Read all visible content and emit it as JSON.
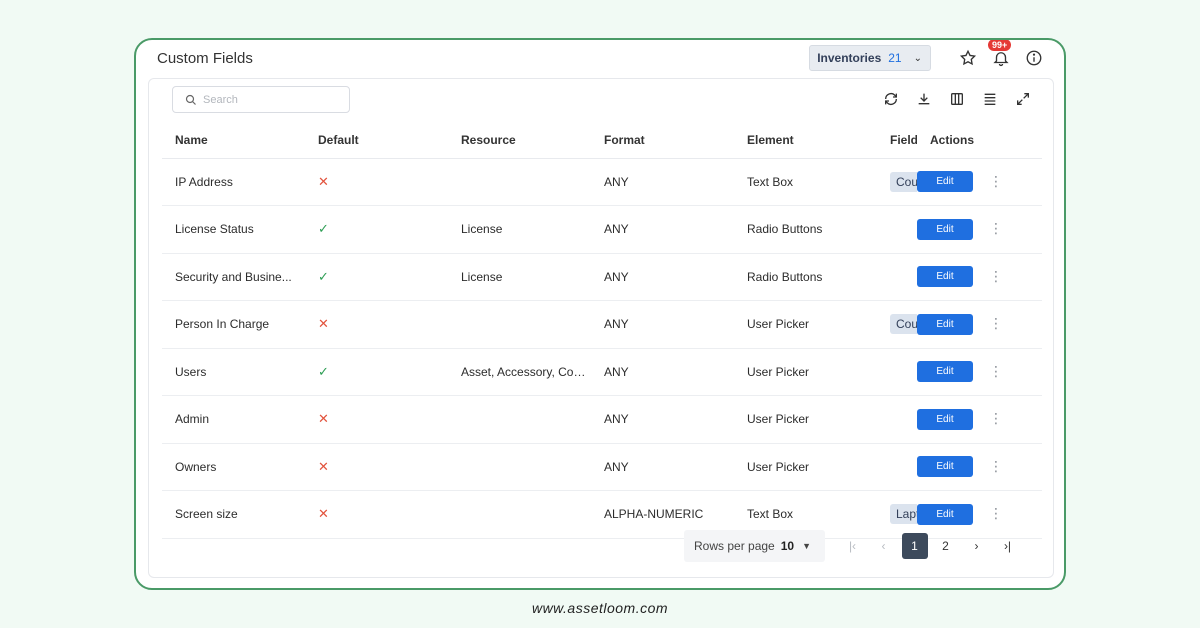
{
  "page": {
    "title": "Custom Fields"
  },
  "topbar": {
    "inventory_label": "Inventories",
    "inventory_count": "21",
    "notification_badge": "99+"
  },
  "search": {
    "placeholder": "Search"
  },
  "toolbar": {
    "icons": [
      "refresh-icon",
      "download-icon",
      "columns-icon",
      "density-icon",
      "fullscreen-icon"
    ]
  },
  "table": {
    "headers": [
      "Name",
      "Default",
      "Resource",
      "Format",
      "Element",
      "Field",
      "Actions"
    ],
    "rows": [
      {
        "name": "IP Address",
        "default": false,
        "resource": "",
        "format": "ANY",
        "element": "Text Box",
        "field": "Cou"
      },
      {
        "name": "License Status",
        "default": true,
        "resource": "License",
        "format": "ANY",
        "element": "Radio Buttons",
        "field": ""
      },
      {
        "name": "Security and Busine...",
        "default": true,
        "resource": "License",
        "format": "ANY",
        "element": "Radio Buttons",
        "field": ""
      },
      {
        "name": "Person In Charge",
        "default": false,
        "resource": "",
        "format": "ANY",
        "element": "User Picker",
        "field": "Cou"
      },
      {
        "name": "Users",
        "default": true,
        "resource": "Asset, Accessory, Compo",
        "format": "ANY",
        "element": "User Picker",
        "field": ""
      },
      {
        "name": "Admin",
        "default": false,
        "resource": "",
        "format": "ANY",
        "element": "User Picker",
        "field": ""
      },
      {
        "name": "Owners",
        "default": false,
        "resource": "",
        "format": "ANY",
        "element": "User Picker",
        "field": ""
      },
      {
        "name": "Screen size",
        "default": false,
        "resource": "",
        "format": "ALPHA-NUMERIC",
        "element": "Text Box",
        "field": "Lapt"
      }
    ],
    "edit_label": "Edit",
    "true_glyph": "✓",
    "false_glyph": "✕"
  },
  "pagination": {
    "rows_per_page_label": "Rows per page",
    "rows_per_page_value": "10",
    "pages": [
      "1",
      "2"
    ],
    "current_page": "1"
  },
  "footer": {
    "url": "www.assetloom.com"
  },
  "colors": {
    "accent": "#1f6fe0",
    "frame_border": "#4a9a67",
    "error": "#e2533d",
    "success": "#2e9e55"
  }
}
